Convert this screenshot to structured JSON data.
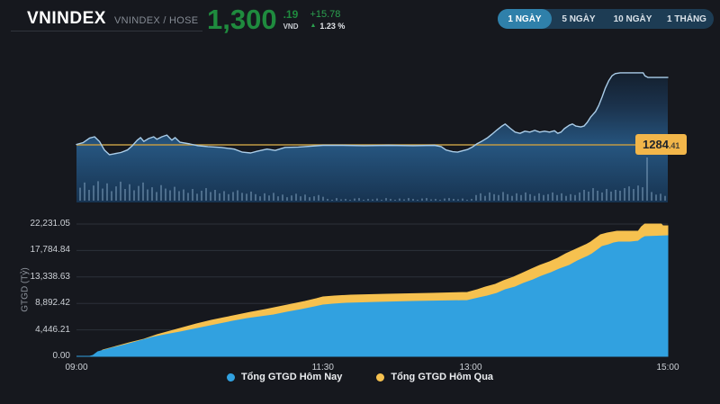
{
  "header": {
    "title": "VNINDEX",
    "subtitle": "VNINDEX / HOSE",
    "price": {
      "value": "1,300",
      "decimals": ".19",
      "currency": "VND",
      "change": "+15.78",
      "change_percent": "1.23 %",
      "direction": "up",
      "up_arrow_glyph": "▲"
    },
    "range_buttons": [
      {
        "label": "1 NGÀY",
        "active": true
      },
      {
        "label": "5 NGÀY",
        "active": false
      },
      {
        "label": "10 NGÀY",
        "active": false
      },
      {
        "label": "1 THÁNG",
        "active": false
      }
    ]
  },
  "colors": {
    "price_green": "#1f8b3e",
    "change_green": "#2ba14f",
    "price_line_blue": "#aacde9",
    "reference_gold": "#c19a44",
    "reference_label_bg": "#f2b64a",
    "today_blue": "#31a1e0",
    "yesterday_yellow": "#f6c14f",
    "active_tab": "#2f80aa",
    "tab_bar": "#1d3c54",
    "grid": "#2c313a",
    "volume_bar": "#8fb0cc"
  },
  "chart_data": [
    {
      "type": "line",
      "title": "VNINDEX intraday price",
      "x_unit": "minutes from 09:00",
      "x_range": [
        0,
        360
      ],
      "y_range": [
        1270.9,
        1305.7
      ],
      "grid": false,
      "reference_line": {
        "value": 1284.41,
        "label_int": "1284",
        "label_dec": ".41"
      },
      "series": [
        {
          "name": "VNINDEX",
          "points": [
            [
              0,
              1284.5
            ],
            [
              4,
              1284.9
            ],
            [
              8,
              1286.0
            ],
            [
              11,
              1286.3
            ],
            [
              14,
              1285.2
            ],
            [
              17,
              1283.2
            ],
            [
              20,
              1282.1
            ],
            [
              23,
              1282.3
            ],
            [
              27,
              1282.6
            ],
            [
              31,
              1283.2
            ],
            [
              34,
              1284.2
            ],
            [
              37,
              1285.5
            ],
            [
              39,
              1286.1
            ],
            [
              41,
              1285.2
            ],
            [
              44,
              1285.9
            ],
            [
              47,
              1286.3
            ],
            [
              49,
              1285.7
            ],
            [
              52,
              1286.3
            ],
            [
              55,
              1286.7
            ],
            [
              58,
              1285.5
            ],
            [
              60,
              1286.1
            ],
            [
              63,
              1285.0
            ],
            [
              69,
              1284.6
            ],
            [
              74,
              1284.2
            ],
            [
              80,
              1284.0
            ],
            [
              88,
              1283.8
            ],
            [
              96,
              1283.4
            ],
            [
              101,
              1282.7
            ],
            [
              106,
              1282.5
            ],
            [
              110,
              1282.9
            ],
            [
              116,
              1283.4
            ],
            [
              121,
              1283.1
            ],
            [
              127,
              1283.8
            ],
            [
              135,
              1283.9
            ],
            [
              143,
              1284.1
            ],
            [
              150,
              1284.3
            ],
            [
              162,
              1284.3
            ],
            [
              175,
              1284.2
            ],
            [
              190,
              1284.3
            ],
            [
              205,
              1284.2
            ],
            [
              218,
              1284.3
            ],
            [
              222,
              1284.0
            ],
            [
              225,
              1283.2
            ],
            [
              229,
              1282.8
            ],
            [
              232,
              1282.7
            ],
            [
              235,
              1283.0
            ],
            [
              238,
              1283.3
            ],
            [
              241,
              1283.9
            ],
            [
              244,
              1284.7
            ],
            [
              247,
              1285.3
            ],
            [
              250,
              1286.0
            ],
            [
              253,
              1286.9
            ],
            [
              256,
              1287.9
            ],
            [
              259,
              1288.8
            ],
            [
              261,
              1289.3
            ],
            [
              264,
              1288.3
            ],
            [
              267,
              1287.4
            ],
            [
              270,
              1287.1
            ],
            [
              273,
              1287.6
            ],
            [
              276,
              1287.4
            ],
            [
              279,
              1287.8
            ],
            [
              282,
              1287.4
            ],
            [
              285,
              1287.6
            ],
            [
              288,
              1287.4
            ],
            [
              291,
              1287.7
            ],
            [
              293,
              1287.1
            ],
            [
              295,
              1287.4
            ],
            [
              297,
              1288.2
            ],
            [
              300,
              1289.0
            ],
            [
              302,
              1289.3
            ],
            [
              304,
              1288.8
            ],
            [
              307,
              1288.6
            ],
            [
              309,
              1288.8
            ],
            [
              311,
              1289.7
            ],
            [
              313,
              1290.9
            ],
            [
              316,
              1292.2
            ],
            [
              318,
              1293.7
            ],
            [
              320,
              1295.6
            ],
            [
              322,
              1297.7
            ],
            [
              324,
              1299.4
            ],
            [
              326,
              1300.6
            ],
            [
              328,
              1301.1
            ],
            [
              331,
              1301.3
            ],
            [
              345,
              1301.3
            ],
            [
              346,
              1300.6
            ],
            [
              348,
              1300.2
            ],
            [
              360,
              1300.2
            ]
          ]
        }
      ],
      "volume_bars_relative": [
        0.3,
        0.42,
        0.25,
        0.35,
        0.45,
        0.28,
        0.4,
        0.22,
        0.33,
        0.44,
        0.27,
        0.38,
        0.24,
        0.34,
        0.42,
        0.26,
        0.31,
        0.2,
        0.36,
        0.28,
        0.24,
        0.32,
        0.22,
        0.26,
        0.18,
        0.27,
        0.16,
        0.23,
        0.29,
        0.2,
        0.25,
        0.17,
        0.22,
        0.15,
        0.2,
        0.24,
        0.18,
        0.16,
        0.21,
        0.15,
        0.1,
        0.17,
        0.12,
        0.18,
        0.1,
        0.14,
        0.08,
        0.12,
        0.16,
        0.1,
        0.14,
        0.08,
        0.1,
        0.13,
        0.09,
        0.04,
        0.02,
        0.06,
        0.03,
        0.04,
        0.02,
        0.05,
        0.06,
        0.02,
        0.04,
        0.03,
        0.05,
        0.02,
        0.06,
        0.04,
        0.02,
        0.05,
        0.03,
        0.06,
        0.04,
        0.02,
        0.05,
        0.06,
        0.03,
        0.04,
        0.02,
        0.05,
        0.06,
        0.04,
        0.03,
        0.05,
        0.02,
        0.04,
        0.13,
        0.17,
        0.11,
        0.19,
        0.15,
        0.13,
        0.2,
        0.15,
        0.11,
        0.17,
        0.13,
        0.19,
        0.15,
        0.11,
        0.17,
        0.13,
        0.15,
        0.19,
        0.13,
        0.17,
        0.11,
        0.15,
        0.13,
        0.19,
        0.25,
        0.21,
        0.29,
        0.23,
        0.19,
        0.27,
        0.21,
        0.25,
        0.23,
        0.29,
        0.33,
        0.27,
        0.35,
        0.31,
        1.0,
        0.2,
        0.14,
        0.16,
        0.11
      ]
    },
    {
      "type": "area",
      "title": "Cumulative trading value",
      "ylabel": "GTGD (Tỷ)",
      "x_unit": "minutes from 09:00",
      "x_range": [
        0,
        360
      ],
      "y_range": [
        0,
        22231.05
      ],
      "grid": true,
      "legend_position": "bottom",
      "y_ticks": [
        {
          "value": 22231.05,
          "label": "22,231.05"
        },
        {
          "value": 17784.84,
          "label": "17,784.84"
        },
        {
          "value": 13338.63,
          "label": "13,338.63"
        },
        {
          "value": 8892.42,
          "label": "8,892.42"
        },
        {
          "value": 4446.21,
          "label": "4,446.21"
        },
        {
          "value": 0,
          "label": "0.00"
        }
      ],
      "x_ticks": [
        {
          "minute": 0,
          "label": "09:00"
        },
        {
          "minute": 150,
          "label": "11:30"
        },
        {
          "minute": 240,
          "label": "13:00"
        },
        {
          "minute": 360,
          "label": "15:00"
        }
      ],
      "series": [
        {
          "name": "Tổng GTGD Hôm Qua",
          "color": "#f6c14f",
          "points": [
            [
              0,
              0
            ],
            [
              9,
              0
            ],
            [
              12,
              300
            ],
            [
              16,
              1060
            ],
            [
              24,
              1660
            ],
            [
              32,
              2270
            ],
            [
              41,
              2870
            ],
            [
              49,
              3630
            ],
            [
              57,
              4230
            ],
            [
              65,
              4840
            ],
            [
              73,
              5440
            ],
            [
              82,
              6050
            ],
            [
              90,
              6500
            ],
            [
              98,
              6960
            ],
            [
              106,
              7410
            ],
            [
              115,
              7860
            ],
            [
              123,
              8320
            ],
            [
              131,
              8770
            ],
            [
              139,
              9230
            ],
            [
              146,
              9680
            ],
            [
              150,
              9980
            ],
            [
              157,
              10130
            ],
            [
              167,
              10280
            ],
            [
              189,
              10440
            ],
            [
              216,
              10590
            ],
            [
              238,
              10740
            ],
            [
              244,
              11190
            ],
            [
              249,
              11650
            ],
            [
              255,
              12100
            ],
            [
              260,
              12700
            ],
            [
              266,
              13310
            ],
            [
              271,
              13910
            ],
            [
              277,
              14670
            ],
            [
              282,
              15270
            ],
            [
              288,
              15880
            ],
            [
              293,
              16480
            ],
            [
              298,
              17240
            ],
            [
              304,
              18000
            ],
            [
              310,
              18750
            ],
            [
              313,
              19210
            ],
            [
              316,
              19810
            ],
            [
              319,
              20420
            ],
            [
              323,
              20720
            ],
            [
              326,
              20870
            ],
            [
              329,
              21020
            ],
            [
              342,
              21020
            ],
            [
              344,
              21780
            ],
            [
              346,
              22231
            ],
            [
              356,
              22231
            ],
            [
              357,
              21930
            ],
            [
              360,
              21930
            ]
          ]
        },
        {
          "name": "Tổng GTGD Hôm Nay",
          "color": "#31a1e0",
          "points": [
            [
              0,
              0
            ],
            [
              8,
              0
            ],
            [
              10,
              150
            ],
            [
              13,
              760
            ],
            [
              21,
              1360
            ],
            [
              30,
              1970
            ],
            [
              38,
              2570
            ],
            [
              46,
              3180
            ],
            [
              54,
              3630
            ],
            [
              63,
              4080
            ],
            [
              71,
              4540
            ],
            [
              79,
              4990
            ],
            [
              87,
              5440
            ],
            [
              95,
              5900
            ],
            [
              104,
              6350
            ],
            [
              112,
              6650
            ],
            [
              120,
              6960
            ],
            [
              128,
              7410
            ],
            [
              137,
              7860
            ],
            [
              145,
              8320
            ],
            [
              150,
              8620
            ],
            [
              156,
              8770
            ],
            [
              164,
              8920
            ],
            [
              183,
              9070
            ],
            [
              205,
              9230
            ],
            [
              238,
              9380
            ],
            [
              245,
              9830
            ],
            [
              250,
              10130
            ],
            [
              256,
              10590
            ],
            [
              261,
              11190
            ],
            [
              267,
              11650
            ],
            [
              272,
              12250
            ],
            [
              278,
              12850
            ],
            [
              283,
              13460
            ],
            [
              289,
              14060
            ],
            [
              294,
              14670
            ],
            [
              300,
              15270
            ],
            [
              305,
              16030
            ],
            [
              311,
              16790
            ],
            [
              314,
              17240
            ],
            [
              317,
              17850
            ],
            [
              320,
              18450
            ],
            [
              324,
              18750
            ],
            [
              327,
              19060
            ],
            [
              330,
              19210
            ],
            [
              337,
              19210
            ],
            [
              342,
              19360
            ],
            [
              344,
              19810
            ],
            [
              346,
              20110
            ],
            [
              360,
              20260
            ]
          ]
        }
      ]
    }
  ]
}
